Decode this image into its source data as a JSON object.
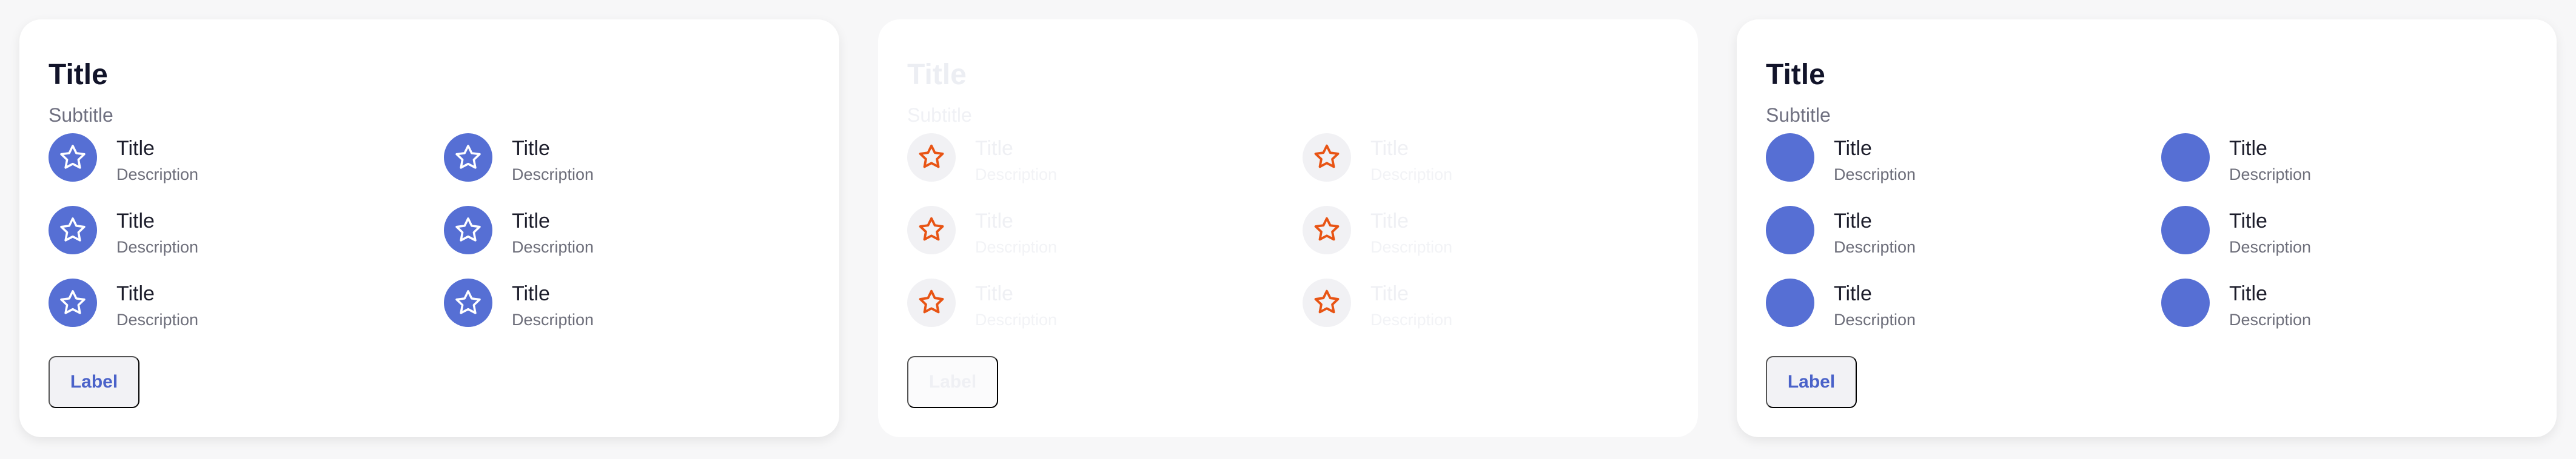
{
  "colors": {
    "accent": "#566fd4",
    "title": "#12142a",
    "subtitle": "#6f7080",
    "star_outline": "#ffffff",
    "disabled_star": "#e85414"
  },
  "cards": [
    {
      "title": "Title",
      "subtitle": "Subtitle",
      "button_label": "Label",
      "icon": "star-icon",
      "items": [
        {
          "title": "Title",
          "description": "Description"
        },
        {
          "title": "Title",
          "description": "Description"
        },
        {
          "title": "Title",
          "description": "Description"
        },
        {
          "title": "Title",
          "description": "Description"
        },
        {
          "title": "Title",
          "description": "Description"
        },
        {
          "title": "Title",
          "description": "Description"
        }
      ]
    },
    {
      "title": "Title",
      "subtitle": "Subtitle",
      "button_label": "Label",
      "icon": "star-icon",
      "items": [
        {
          "title": "Title",
          "description": "Description"
        },
        {
          "title": "Title",
          "description": "Description"
        },
        {
          "title": "Title",
          "description": "Description"
        },
        {
          "title": "Title",
          "description": "Description"
        },
        {
          "title": "Title",
          "description": "Description"
        },
        {
          "title": "Title",
          "description": "Description"
        }
      ]
    },
    {
      "title": "Title",
      "subtitle": "Subtitle",
      "button_label": "Label",
      "icon": "blank-avatar",
      "items": [
        {
          "title": "Title",
          "description": "Description"
        },
        {
          "title": "Title",
          "description": "Description"
        },
        {
          "title": "Title",
          "description": "Description"
        },
        {
          "title": "Title",
          "description": "Description"
        },
        {
          "title": "Title",
          "description": "Description"
        },
        {
          "title": "Title",
          "description": "Description"
        }
      ]
    }
  ]
}
